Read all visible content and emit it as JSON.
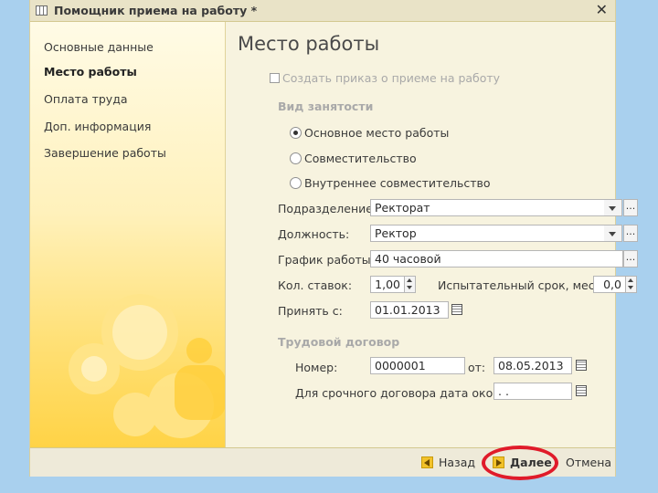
{
  "window": {
    "title": "Помощник приема на работу *",
    "close_glyph": "✕"
  },
  "sidebar": {
    "items": [
      {
        "label": "Основные данные",
        "active": false
      },
      {
        "label": "Место работы",
        "active": true
      },
      {
        "label": "Оплата труда",
        "active": false
      },
      {
        "label": "Доп. информация",
        "active": false
      },
      {
        "label": "Завершение работы",
        "active": false
      }
    ]
  },
  "main": {
    "title": "Место работы",
    "create_order_label": "Создать приказ о приеме на работу",
    "employment_type": {
      "heading": "Вид занятости",
      "options": [
        "Основное место работы",
        "Совместительство",
        "Внутреннее совместительство"
      ],
      "selected": "Основное место работы"
    },
    "fields": {
      "department": {
        "label": "Подразделение:",
        "value": "Ректорат"
      },
      "position": {
        "label": "Должность:",
        "value": "Ректор"
      },
      "schedule": {
        "label": "График работы:",
        "value": "40 часовой"
      },
      "rates": {
        "label": "Кол. ставок:",
        "value": "1,00"
      },
      "probation": {
        "label": "Испытательный срок, мес.:",
        "value": "0,0"
      },
      "hire_date": {
        "label": "Принять с:",
        "value": "01.01.2013"
      }
    },
    "contract": {
      "heading": "Трудовой договор",
      "number_label": "Номер:",
      "number_value": "0000001",
      "from_label": "от:",
      "from_value": "08.05.2013",
      "term_end_label": "Для срочного договора дата оконч.:",
      "term_end_value": " .  .  "
    },
    "select_button_text": "..."
  },
  "footer": {
    "back_label": "Назад",
    "next_label": "Далее",
    "cancel_label": "Отмена"
  },
  "colors": {
    "window_bg": "#f7f3df",
    "sidebar_gradient_bottom": "#ffd346",
    "highlight_circle": "#e01b2a",
    "desktop_bg": "#a9d0ee"
  }
}
